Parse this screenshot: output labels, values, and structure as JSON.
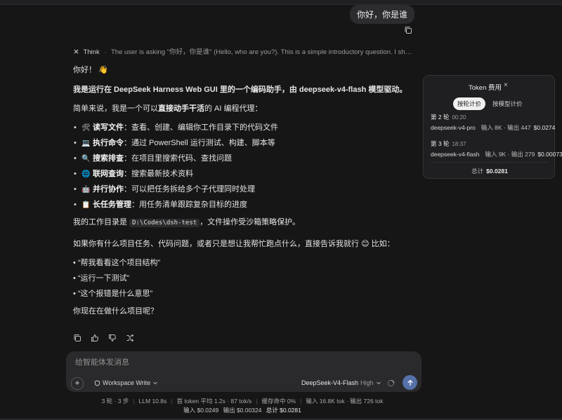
{
  "conversation": {
    "user_message": "你好，你是谁",
    "think": {
      "label": "Think",
      "text": "The user is asking \"你好，你是谁\" (Hello, who are you?). This is a simple introductory question. I should res..."
    },
    "assistant": {
      "greeting": "你好！",
      "greeting_emoji": "👋",
      "intro": "我是运行在 DeepSeek Harness Web GUI 里的一个编码助手，由 deepseek-v4-flash 模型驱动。",
      "simple_prefix": "简单来说，我是一个可以",
      "simple_bold": "直接动手干活",
      "simple_suffix": "的 AI 编程代理：",
      "capabilities": [
        {
          "emoji": "🛠",
          "title": "读写文件",
          "desc": "：查看、创建、编辑你工作目录下的代码文件"
        },
        {
          "emoji": "💻",
          "title": "执行命令",
          "desc": "：通过 PowerShell 运行测试、构建、脚本等"
        },
        {
          "emoji": "🔍",
          "title": "搜索排查",
          "desc": "：在项目里搜索代码、查找问题"
        },
        {
          "emoji": "🌐",
          "title": "联网查询",
          "desc": "：搜索最新技术资料"
        },
        {
          "emoji": "🤖",
          "title": "并行协作",
          "desc": "：可以把任务拆给多个子代理同时处理"
        },
        {
          "emoji": "📋",
          "title": "长任务管理",
          "desc": "：用任务清单跟踪复杂目标的进度"
        }
      ],
      "workdir_prefix": "我的工作目录是",
      "workdir_code": "D:\\Codes\\dsh-test",
      "workdir_suffix": "，文件操作受沙箱策略保护。",
      "ask_text": "如果你有什么项目任务、代码问题，或者只是想让我帮忙跑点什么，直接告诉我就行",
      "ask_emoji": "😊",
      "ask_suffix": "比如：",
      "examples": [
        "“帮我看看这个项目结构”",
        "“运行一下测试”",
        "“这个报错是什么意思”"
      ],
      "closing": "你现在在做什么项目呢？"
    },
    "action_icons": [
      "copy-icon",
      "thumbs-up-icon",
      "thumbs-down-icon",
      "branch-icon"
    ]
  },
  "token_panel": {
    "title": "Token 费用",
    "close": "×",
    "tabs": [
      "按轮计价",
      "按模型计价"
    ],
    "active_tab": 0,
    "rounds": [
      {
        "label": "第 2 轮",
        "time": "00:20",
        "model": "deepseek-v4-pro",
        "io": "输入 8K · 输出 447",
        "cost": "$0.0274"
      },
      {
        "label": "第 3 轮",
        "time": "18:37",
        "model": "deepseek-v4-flash",
        "io": "输入 9K · 输出 279",
        "cost": "$0.00073"
      }
    ],
    "total_label": "总计",
    "total_value": "$0.0281"
  },
  "composer": {
    "placeholder": "给智能体发消息",
    "workspace_label": "Workspace Write",
    "model_name": "DeepSeek-V4-Flash",
    "model_level": "High"
  },
  "status": {
    "line1": [
      "3 轮 · 3 步",
      "LLM 10.8s",
      "首 token 平均 1.2s · 87 tok/s",
      "缓存命中 0%",
      "输入 16.8K tok · 输出 726 tok"
    ],
    "input_cost": "输入 $0.0249",
    "output_cost": "输出 $0.00324",
    "total_cost": "总计 $0.0281"
  },
  "colors": {
    "background": "#161617",
    "send_button": "#5571a8",
    "panel": "#1f1f21",
    "composer": "#2a2a2c"
  }
}
